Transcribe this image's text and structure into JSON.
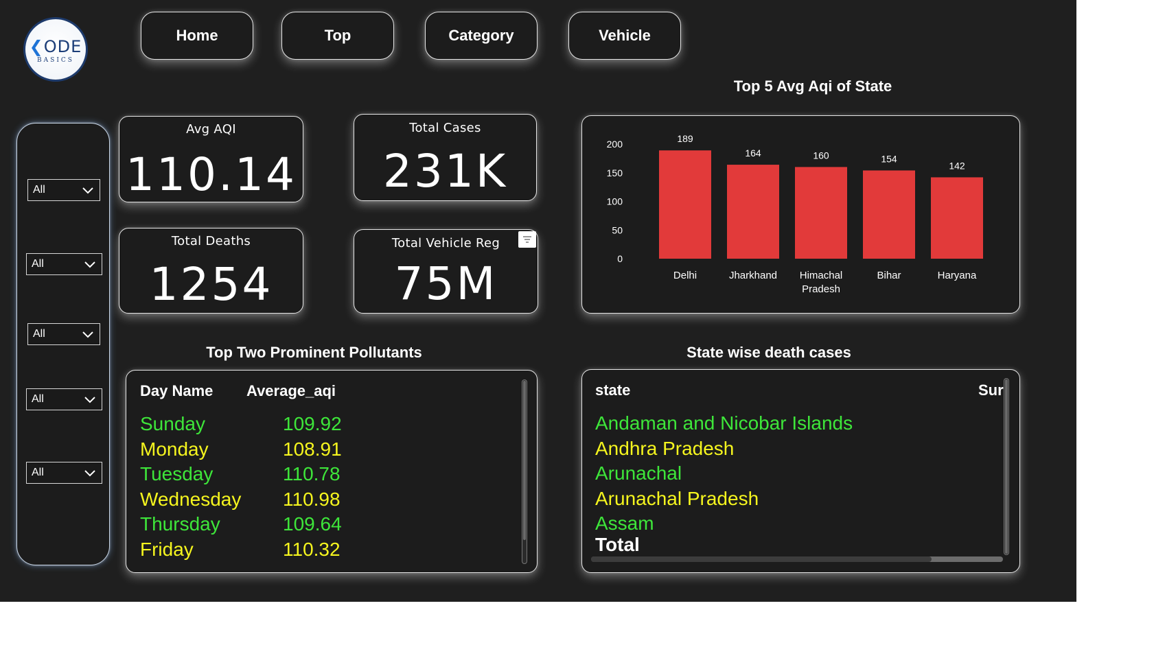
{
  "logo": {
    "brand": "ODE",
    "sub": "BASICS"
  },
  "nav": {
    "home_label": "Home",
    "top_label": "Top",
    "category_label": "Category",
    "vehicle_label": "Vehicle"
  },
  "slicers": [
    {
      "value": "All"
    },
    {
      "value": "All"
    },
    {
      "value": "All"
    },
    {
      "value": "All"
    },
    {
      "value": "All"
    }
  ],
  "kpis": {
    "avg_aqi": {
      "title": "Avg AQI",
      "value": "110.14"
    },
    "total_cases": {
      "title": "Total Cases",
      "value": "231K"
    },
    "total_deaths": {
      "title": "Total Deaths",
      "value": "1254"
    },
    "total_vehicle_reg": {
      "title": "Total Vehicle Reg",
      "value": "75M"
    }
  },
  "chart_title": "Top 5 Avg Aqi of State",
  "chart_data": {
    "type": "bar",
    "title": "Top 5 Avg Aqi of State",
    "categories": [
      "Delhi",
      "Jharkhand",
      "Himachal Pradesh",
      "Bihar",
      "Haryana"
    ],
    "values": [
      189,
      164,
      160,
      154,
      142
    ],
    "ylim": [
      0,
      200
    ],
    "yticks": [
      0,
      50,
      100,
      150,
      200
    ],
    "xlabel": "",
    "ylabel": "",
    "bar_color": "#e23a3a",
    "grid": false
  },
  "pollutants": {
    "title": "Top Two Prominent Pollutants",
    "headers": [
      "Day Name",
      "Average_aqi"
    ],
    "rows": [
      {
        "day": "Sunday",
        "aqi": "109.92",
        "color": "#3ee63a"
      },
      {
        "day": "Monday",
        "aqi": "108.91",
        "color": "#f5f51e"
      },
      {
        "day": "Tuesday",
        "aqi": "110.78",
        "color": "#3ee63a"
      },
      {
        "day": "Wednesday",
        "aqi": "110.98",
        "color": "#f5f51e"
      },
      {
        "day": "Thursday",
        "aqi": "109.64",
        "color": "#3ee63a"
      },
      {
        "day": "Friday",
        "aqi": "110.32",
        "color": "#f5f51e"
      }
    ]
  },
  "deaths": {
    "title": "State wise death cases",
    "headers": [
      "state",
      "Sur"
    ],
    "rows": [
      {
        "state": "Andaman and Nicobar Islands",
        "color": "#3ee63a"
      },
      {
        "state": "Andhra Pradesh",
        "color": "#f5f51e"
      },
      {
        "state": "Arunachal",
        "color": "#3ee63a"
      },
      {
        "state": "Arunachal Pradesh",
        "color": "#f5f51e"
      },
      {
        "state": "Assam",
        "color": "#3ee63a"
      }
    ],
    "total_label": "Total"
  }
}
